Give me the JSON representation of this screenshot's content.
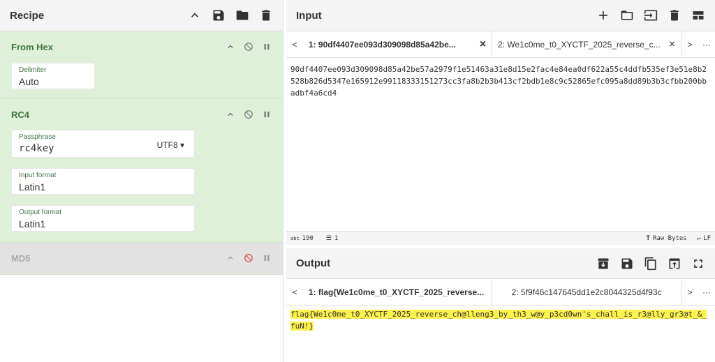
{
  "recipe": {
    "title": "Recipe",
    "operations": [
      {
        "name": "From Hex",
        "args": [
          {
            "label": "Delimiter",
            "value": "Auto"
          }
        ]
      },
      {
        "name": "RC4",
        "args": [
          {
            "label": "Passphrase",
            "value": "rc4key",
            "dropdown": "UTF8"
          },
          {
            "label": "Input format",
            "value": "Latin1"
          },
          {
            "label": "Output format",
            "value": "Latin1"
          }
        ]
      },
      {
        "name": "MD5",
        "args": []
      }
    ]
  },
  "input": {
    "title": "Input",
    "tabs": [
      {
        "label": "1: 90df4407ee093d309098d85a42be..."
      },
      {
        "label": "2: We1c0me_t0_XYCTF_2025_reverse_c..."
      }
    ],
    "nav_prev": "<",
    "nav_next": ">",
    "nav_more": "···",
    "text": "90df4407ee093d309098d85a42be57a2979f1e51463a31e8d15e2fac4e84ea0df622a55c4ddfb535ef3e51e8b2528b826d5347e165912e99118333151273cc3fa8b2b3b413cf2bdb1e8c9c52865efc095a8dd89b3b3cfbb200bbadbf4a6cd4",
    "status": {
      "abc_label": "abc",
      "length": "190",
      "lines": "1",
      "raw_bytes": "Raw Bytes",
      "line_ending": "LF"
    }
  },
  "output": {
    "title": "Output",
    "tabs": [
      {
        "label": "1: flag{We1c0me_t0_XYCTF_2025_reverse..."
      },
      {
        "label": "2: 5f9f46c147645dd1e2c8044325d4f93c"
      }
    ],
    "nav_prev": "<",
    "nav_next": ">",
    "nav_more": "···",
    "text": "flag{We1c0me_t0_XYCTF_2025_reverse_ch@lleng3_by_th3_w@y_p3cd0wn's_chall_is_r3@lly_gr3@t_&_fuN!}"
  },
  "colors": {
    "enabled_op_bg": "#dff0d8",
    "disabled_op_bg": "#e2e2e2",
    "op_title": "#3c763d",
    "disabled_icon": "#e43f3f",
    "highlight": "#fff24d"
  }
}
